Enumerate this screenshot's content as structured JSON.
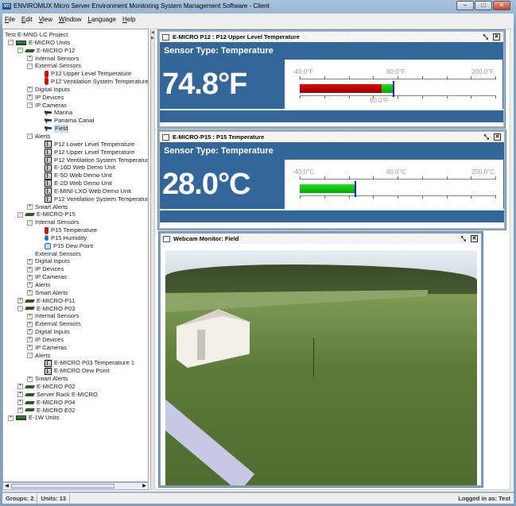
{
  "window": {
    "title": "ENVIROMUX Micro Server Environment Monitoring System Management Software - Client",
    "logo": "NTI"
  },
  "menu": [
    "File",
    "Edit",
    "View",
    "Window",
    "Language",
    "Help"
  ],
  "tree": [
    {
      "l": 0,
      "e": "",
      "i": "",
      "t": "Test E-MNG-LC Project"
    },
    {
      "l": 0,
      "e": "-",
      "i": "unit",
      "t": "E-MICRO Units"
    },
    {
      "l": 1,
      "e": "-",
      "i": "dev",
      "t": "E-MICRO P12"
    },
    {
      "l": 2,
      "e": "+",
      "i": "",
      "t": "Internal Sensors"
    },
    {
      "l": 2,
      "e": "-",
      "i": "",
      "t": "External Sensors"
    },
    {
      "l": 3,
      "e": "",
      "i": "temp",
      "t": "P12 Upper Level Temperature"
    },
    {
      "l": 3,
      "e": "",
      "i": "temp",
      "t": "P12 Ventilation System Temperature"
    },
    {
      "l": 2,
      "e": "+",
      "i": "",
      "t": "Digital Inputs"
    },
    {
      "l": 2,
      "e": "+",
      "i": "",
      "t": "IP Devices"
    },
    {
      "l": 2,
      "e": "-",
      "i": "",
      "t": "IP Cameras"
    },
    {
      "l": 3,
      "e": "",
      "i": "cam",
      "t": "Marina"
    },
    {
      "l": 3,
      "e": "",
      "i": "cam",
      "t": "Panama Canal"
    },
    {
      "l": 3,
      "e": "",
      "i": "cam",
      "t": "Field",
      "sel": true
    },
    {
      "l": 2,
      "e": "-",
      "i": "",
      "t": "Alerts"
    },
    {
      "l": 3,
      "e": "",
      "i": "alert",
      "t": "P12 Lower Level Temperature"
    },
    {
      "l": 3,
      "e": "",
      "i": "alert",
      "t": "P12 Upper Level Temperature"
    },
    {
      "l": 3,
      "e": "",
      "i": "alert",
      "t": "P12 Ventilation System Temperature"
    },
    {
      "l": 3,
      "e": "",
      "i": "alert",
      "t": "E-16D Web Demo Unit"
    },
    {
      "l": 3,
      "e": "",
      "i": "alert",
      "t": "E-5D Web Demo Unit"
    },
    {
      "l": 3,
      "e": "",
      "i": "alert",
      "t": "E-2D Web Demo Unit"
    },
    {
      "l": 3,
      "e": "",
      "i": "alert",
      "t": "E-MINI-LXO Web Demo Unit"
    },
    {
      "l": 3,
      "e": "",
      "i": "alert",
      "t": "P12 Ventilation System Temperature"
    },
    {
      "l": 2,
      "e": "+",
      "i": "",
      "t": "Smart Alerts"
    },
    {
      "l": 1,
      "e": "-",
      "i": "dev",
      "t": "E-MICRO-P15"
    },
    {
      "l": 2,
      "e": "-",
      "i": "",
      "t": "Internal Sensors"
    },
    {
      "l": 3,
      "e": "",
      "i": "temp",
      "t": "P15 Temperature"
    },
    {
      "l": 3,
      "e": "",
      "i": "hum",
      "t": "P15 Humidity"
    },
    {
      "l": 3,
      "e": "",
      "i": "dew",
      "t": "P15 Dew Point"
    },
    {
      "l": 2,
      "e": "",
      "i": "",
      "t": "External Sensors"
    },
    {
      "l": 2,
      "e": "+",
      "i": "",
      "t": "Digital Inputs"
    },
    {
      "l": 2,
      "e": "+",
      "i": "",
      "t": "IP Devices"
    },
    {
      "l": 2,
      "e": "+",
      "i": "",
      "t": "IP Cameras"
    },
    {
      "l": 2,
      "e": "+",
      "i": "",
      "t": "Alerts"
    },
    {
      "l": 2,
      "e": "+",
      "i": "",
      "t": "Smart Alerts"
    },
    {
      "l": 1,
      "e": "+",
      "i": "dev",
      "t": "E-MICRO-P11"
    },
    {
      "l": 1,
      "e": "-",
      "i": "dev",
      "t": "E-MICRO P03"
    },
    {
      "l": 2,
      "e": "+",
      "i": "",
      "t": "Internal Sensors"
    },
    {
      "l": 2,
      "e": "+",
      "i": "",
      "t": "External Sensors"
    },
    {
      "l": 2,
      "e": "+",
      "i": "",
      "t": "Digital Inputs"
    },
    {
      "l": 2,
      "e": "+",
      "i": "",
      "t": "IP Devices"
    },
    {
      "l": 2,
      "e": "+",
      "i": "",
      "t": "IP Cameras"
    },
    {
      "l": 2,
      "e": "-",
      "i": "",
      "t": "Alerts"
    },
    {
      "l": 3,
      "e": "",
      "i": "alert",
      "t": "E-MICRO P03 Temperatiure 1"
    },
    {
      "l": 3,
      "e": "",
      "i": "alert",
      "t": "E-MICRO Dew Point"
    },
    {
      "l": 2,
      "e": "+",
      "i": "",
      "t": "Smart Alerts"
    },
    {
      "l": 1,
      "e": "+",
      "i": "dev",
      "t": "E-MICRO P02"
    },
    {
      "l": 1,
      "e": "+",
      "i": "dev",
      "t": "Server Rack E-MICRO"
    },
    {
      "l": 1,
      "e": "+",
      "i": "dev",
      "t": "E-MICRO P04"
    },
    {
      "l": 1,
      "e": "+",
      "i": "dev",
      "t": "E-MICRO E02"
    },
    {
      "l": 0,
      "e": "+",
      "i": "unit",
      "t": "E-1W Units"
    }
  ],
  "sensors": [
    {
      "title": "E-MICRO P12 : P12 Upper Level Temperature",
      "type": "Sensor Type: Temperature",
      "value": "74.8°F",
      "min_label": "-40.0°F",
      "mid_label": "80.0°F",
      "max_label": "200.0°F",
      "low_label": "60.0°F",
      "min": -40,
      "max": 200,
      "reading": 74.8,
      "threshold": 60,
      "colors": {
        "below": "#dd0000",
        "above": "#22dd22"
      }
    },
    {
      "title": "E-MICRO-P15 : P15 Temperature",
      "type": "Sensor Type: Temperature",
      "value": "28.0°C",
      "min_label": "-40.0°C",
      "mid_label": "80.0°C",
      "max_label": "200.0°C",
      "min": -40,
      "max": 200,
      "reading": 28.0,
      "colors": {
        "above": "#22dd22"
      }
    }
  ],
  "webcam": {
    "title": "Webcam Monitor: Field"
  },
  "status": {
    "groups": "Groups: 2",
    "units": "Units: 13",
    "login": "Logged in as: Test"
  }
}
